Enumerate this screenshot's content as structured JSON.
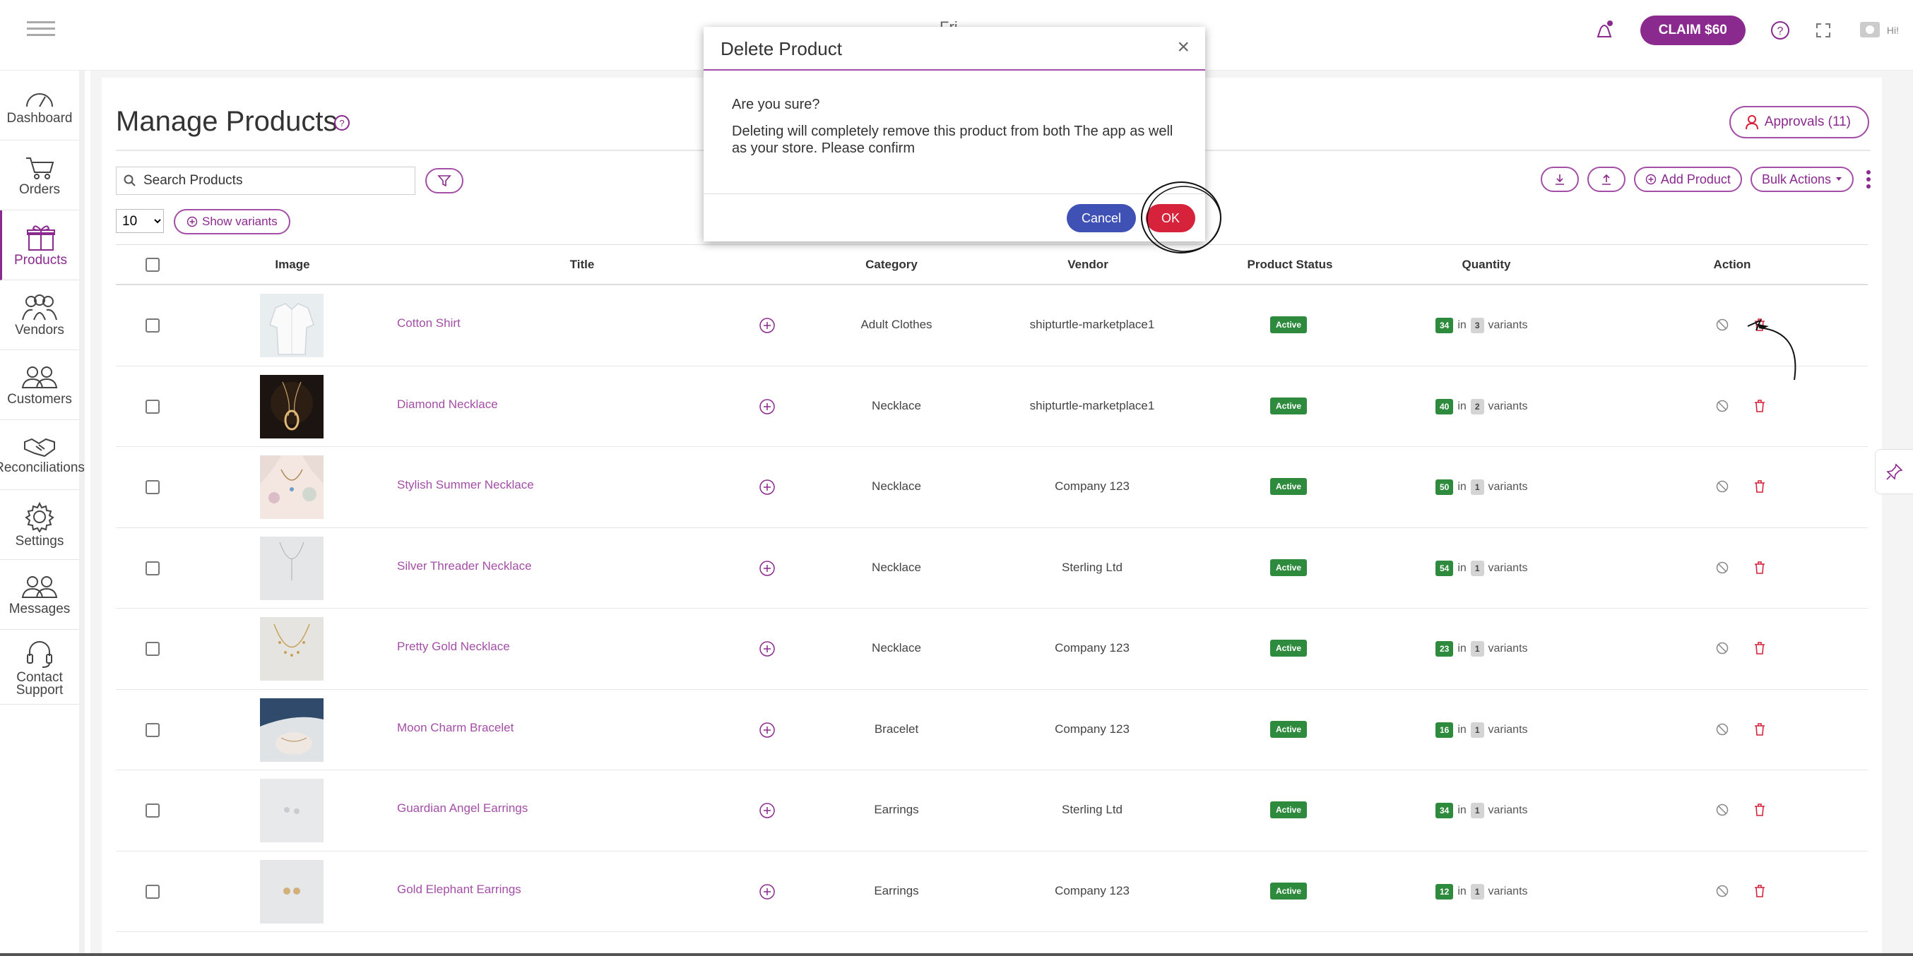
{
  "topbar": {
    "title": "Fri",
    "claim_label": "CLAIM $60",
    "user_label": "Hi!"
  },
  "sidebar": {
    "items": [
      {
        "label": "Dashboard"
      },
      {
        "label": "Orders"
      },
      {
        "label": "Products"
      },
      {
        "label": "Vendors"
      },
      {
        "label": "Customers"
      },
      {
        "label": "Reconciliations"
      },
      {
        "label": "Settings"
      },
      {
        "label": "Messages"
      },
      {
        "label": "Contact Support"
      }
    ],
    "active": "Products"
  },
  "page": {
    "title": "Manage Products",
    "approvals_label": "Approvals (11)",
    "search_placeholder": "Search Products",
    "page_size": "10",
    "show_variants_label": "Show variants",
    "add_product_label": "Add Product",
    "bulk_actions_label": "Bulk Actions"
  },
  "table": {
    "headers": {
      "image": "Image",
      "title": "Title",
      "category": "Category",
      "vendor": "Vendor",
      "status": "Product Status",
      "quantity": "Quantity",
      "action": "Action"
    },
    "in_word": "in",
    "variants_word": "variants",
    "rows": [
      {
        "title": "Cotton Shirt",
        "category": "Adult Clothes",
        "vendor": "shipturtle-marketplace1",
        "status": "Active",
        "qty": "34",
        "variants": "3"
      },
      {
        "title": "Diamond Necklace",
        "category": "Necklace",
        "vendor": "shipturtle-marketplace1",
        "status": "Active",
        "qty": "40",
        "variants": "2"
      },
      {
        "title": "Stylish Summer Necklace",
        "category": "Necklace",
        "vendor": "Company 123",
        "status": "Active",
        "qty": "50",
        "variants": "1"
      },
      {
        "title": "Silver Threader Necklace",
        "category": "Necklace",
        "vendor": "Sterling Ltd",
        "status": "Active",
        "qty": "54",
        "variants": "1"
      },
      {
        "title": "Pretty Gold Necklace",
        "category": "Necklace",
        "vendor": "Company 123",
        "status": "Active",
        "qty": "23",
        "variants": "1"
      },
      {
        "title": "Moon Charm Bracelet",
        "category": "Bracelet",
        "vendor": "Company 123",
        "status": "Active",
        "qty": "16",
        "variants": "1"
      },
      {
        "title": "Guardian Angel Earrings",
        "category": "Earrings",
        "vendor": "Sterling Ltd",
        "status": "Active",
        "qty": "34",
        "variants": "1"
      },
      {
        "title": "Gold Elephant Earrings",
        "category": "Earrings",
        "vendor": "Company 123",
        "status": "Active",
        "qty": "12",
        "variants": "1"
      }
    ]
  },
  "modal": {
    "title": "Delete Product",
    "question": "Are you sure?",
    "message": "Deleting will completely remove this product from both The app as well as your store. Please confirm",
    "cancel_label": "Cancel",
    "ok_label": "OK"
  },
  "colors": {
    "brand": "#8a2a8e",
    "active_badge": "#2e8b3e",
    "danger": "#d6223a",
    "cancel": "#3f51b5"
  }
}
